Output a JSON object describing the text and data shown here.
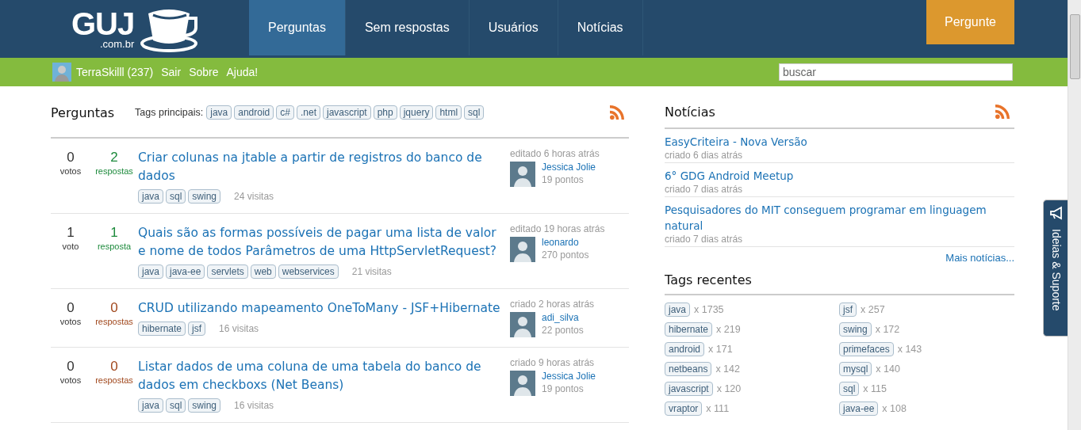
{
  "header": {
    "logo": {
      "text": "GUJ",
      "subtext": ".com.br"
    },
    "nav": [
      {
        "label": "Perguntas",
        "selected": true
      },
      {
        "label": "Sem respostas",
        "selected": false
      },
      {
        "label": "Usuários",
        "selected": false
      },
      {
        "label": "Notícias",
        "selected": false
      }
    ],
    "ask_button": "Pergunte"
  },
  "user_bar": {
    "user": "TerraSkilll (237)",
    "links": [
      "Sair",
      "Sobre",
      "Ajuda!"
    ],
    "search": {
      "placeholder": "buscar"
    }
  },
  "questions": {
    "title": "Perguntas",
    "tags_label": "Tags principais:",
    "main_tags": [
      "java",
      "android",
      "c#",
      ".net",
      "javascript",
      "php",
      "jquery",
      "html",
      "sql"
    ],
    "rows": [
      {
        "votes": "0",
        "votes_label": "votos",
        "answers": "2",
        "answers_label": "respostas",
        "answered": true,
        "title": "Criar colunas na jtable a partir de registros do banco de dados",
        "tags": [
          "java",
          "sql",
          "swing"
        ],
        "visits": "24 visitas",
        "activity": "editado 6 horas atrás",
        "user": "Jessica Jolie",
        "points": "19 pontos"
      },
      {
        "votes": "1",
        "votes_label": "voto",
        "answers": "1",
        "answers_label": "resposta",
        "answered": true,
        "title": "Quais são as formas possíveis de pagar uma lista de valor e nome de todos Parâmetros de uma HttpServletRequest?",
        "tags": [
          "java",
          "java-ee",
          "servlets",
          "web",
          "webservices"
        ],
        "visits": "21 visitas",
        "activity": "editado 19 horas atrás",
        "user": "leonardo",
        "points": "270 pontos"
      },
      {
        "votes": "0",
        "votes_label": "votos",
        "answers": "0",
        "answers_label": "respostas",
        "answered": false,
        "title": "CRUD utilizando mapeamento OneToMany - JSF+Hibernate",
        "tags": [
          "hibernate",
          "jsf"
        ],
        "visits": "16 visitas",
        "activity": "criado 2 horas atrás",
        "user": "adi_silva",
        "points": "22 pontos"
      },
      {
        "votes": "0",
        "votes_label": "votos",
        "answers": "0",
        "answers_label": "respostas",
        "answered": false,
        "title": "Listar dados de uma coluna de uma tabela do banco de dados em checkboxs (Net Beans)",
        "tags": [
          "java",
          "sql",
          "swing"
        ],
        "visits": "16 visitas",
        "activity": "criado 9 horas atrás",
        "user": "Jessica Jolie",
        "points": "19 pontos"
      }
    ]
  },
  "news": {
    "title": "Notícias",
    "items": [
      {
        "title": "EasyCriteira - Nova Versão",
        "meta": "criado 6 dias atrás"
      },
      {
        "title": "6° GDG Android Meetup",
        "meta": "criado 7 dias atrás"
      },
      {
        "title": "Pesquisadores do MIT conseguem programar em linguagem natural",
        "meta": "criado 7 dias atrás"
      }
    ],
    "more": "Mais notícias..."
  },
  "recent_tags": {
    "title": "Tags recentes",
    "items": [
      {
        "tag": "java",
        "count": "x 1735"
      },
      {
        "tag": "jsf",
        "count": "x 257"
      },
      {
        "tag": "hibernate",
        "count": "x 219"
      },
      {
        "tag": "swing",
        "count": "x 172"
      },
      {
        "tag": "android",
        "count": "x 171"
      },
      {
        "tag": "primefaces",
        "count": "x 143"
      },
      {
        "tag": "netbeans",
        "count": "x 142"
      },
      {
        "tag": "mysql",
        "count": "x 140"
      },
      {
        "tag": "javascript",
        "count": "x 120"
      },
      {
        "tag": "sql",
        "count": "x 115"
      },
      {
        "tag": "vraptor",
        "count": "x 111"
      },
      {
        "tag": "java-ee",
        "count": "x 108"
      }
    ]
  },
  "feedback_tab": "Ideias & Suporte"
}
